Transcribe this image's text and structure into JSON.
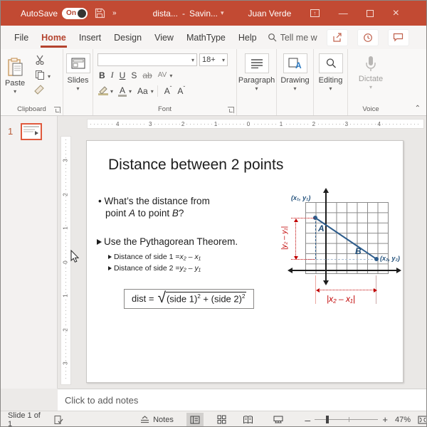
{
  "colors": {
    "titlebar_red": "#c24a33",
    "accent_red": "#b4432e",
    "diagram_blue": "#2e5d8c",
    "diagram_dark_blue": "#1f4e79",
    "diagram_red": "#c00000",
    "thumb_select_orange": "#e0593d"
  },
  "titlebar": {
    "autosave_label": "AutoSave",
    "autosave_state": "On",
    "doc_name": "dista...",
    "separator": "-",
    "saving_status": "Savin...",
    "user_name": "Juan Verde"
  },
  "icons": {
    "dropdown": "▾",
    "double_chevron": "»",
    "minimize": "—",
    "close": "×",
    "ribbon_display_arrow": "↑",
    "collapse_ribbon": "⌃",
    "bullet_dot": "•",
    "zoom_minus": "–",
    "zoom_plus": "+"
  },
  "tabs": [
    {
      "label": "File"
    },
    {
      "label": "Home"
    },
    {
      "label": "Insert"
    },
    {
      "label": "Design"
    },
    {
      "label": "View"
    },
    {
      "label": "MathType"
    },
    {
      "label": "Help"
    }
  ],
  "tellme": {
    "label": "Tell me w"
  },
  "ribbon": {
    "clipboard": {
      "group_label": "Clipboard",
      "paste_label": "Paste"
    },
    "slides": {
      "label": "Slides"
    },
    "font": {
      "group_label": "Font",
      "font_name": "",
      "font_size": "18+",
      "bold": "B",
      "italic": "I",
      "underline": "U",
      "shadow": "S",
      "strikethrough": "ab",
      "char_spacing": "AV",
      "change_case": "Aa",
      "grow_font": "A",
      "shrink_font": "A",
      "grow_mark": "ˆ",
      "shrink_mark": "ˇ",
      "clear_format": "A"
    },
    "paragraph": {
      "label": "Paragraph"
    },
    "drawing": {
      "label": "Drawing",
      "icon_letter": "A"
    },
    "editing": {
      "label": "Editing"
    },
    "voice": {
      "group_label": "Voice",
      "dictate_label": "Dictate"
    }
  },
  "rulers": {
    "horizontal": [
      "4",
      "3",
      "2",
      "1",
      "0",
      "1",
      "2",
      "3",
      "4"
    ],
    "vertical": [
      "3",
      "2",
      "1",
      "0",
      "1",
      "2",
      "3"
    ]
  },
  "thumbnail_panel": {
    "slide_number": "1"
  },
  "slide": {
    "title": "Distance between 2 points",
    "bullet1_line1": "What’s the distance from",
    "bullet1_pre": "point ",
    "bullet1_a": "A",
    "bullet1_mid": " to point ",
    "bullet1_b": "B",
    "bullet1_end": "?",
    "bullet2": "Use the Pythagorean Theorem.",
    "sub1_text": "Distance of side 1 = ",
    "sub1_math": "x₂ – x₁",
    "sub2_text": "Distance of side 2 = ",
    "sub2_math": "y₂ – y₁",
    "formula": {
      "lhs": "dist =",
      "sqrt": "√",
      "t1": "(side 1)",
      "e1": "2",
      "plus": " + ",
      "t2": "(side 2)",
      "e2": "2"
    }
  },
  "diagram": {
    "p1_label": "(x₁, y₁)",
    "p2_label": "(x₂, y₂)",
    "point_a": "A",
    "point_b": "B",
    "dy_label": "|y₂ – y₁|",
    "dx_label": "|x₂ – x₁|"
  },
  "notes": {
    "placeholder": "Click to add notes"
  },
  "statusbar": {
    "slide_indicator": "Slide 1 of 1",
    "notes_label": "Notes",
    "zoom_level": "47%"
  }
}
